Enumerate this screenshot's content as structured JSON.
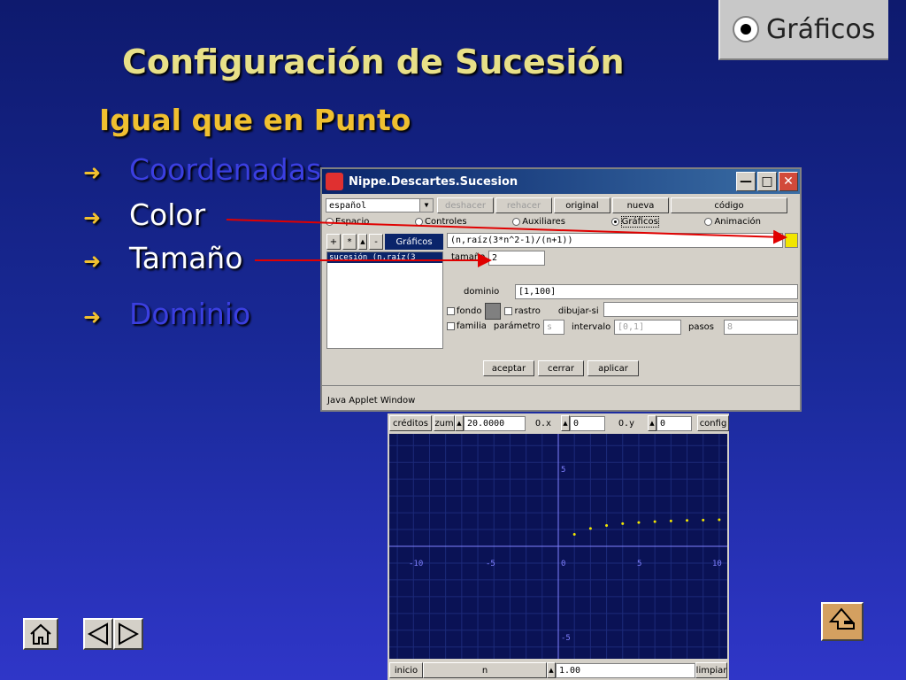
{
  "badge": {
    "label": "Gráficos"
  },
  "title": "Configuración de Sucesión",
  "subtitle": "Igual que en Punto",
  "bullets": {
    "b1": "Coordenadas",
    "b2": "Color",
    "b3": "Tamaño",
    "b4": "Dominio"
  },
  "applet": {
    "window_title": "Nippe.Descartes.Sucesion",
    "language": "español",
    "buttons": {
      "undo": "deshacer",
      "redo": "rehacer",
      "original": "original",
      "new": "nueva",
      "code": "código"
    },
    "tabs": {
      "t1": "Espacio",
      "t2": "Controles",
      "t3": "Auxiliares",
      "t4": "Gráficos",
      "t5": "Animación"
    },
    "list_buttons": {
      "add": "+",
      "star": "*",
      "minus": "-"
    },
    "list_header": "Gráficos",
    "list_item": "sucesión (n,raíz(3",
    "expression": "(n,raíz(3*n^2-1)/(n+1))",
    "color_swatch": "#f2e600",
    "size_label": "tamaño",
    "size_value": "2",
    "domain_label": "dominio",
    "domain_value": "[1,100]",
    "bg_label": "fondo",
    "trace_label": "rastro",
    "drawif_label": "dibujar-si",
    "family_label": "familia",
    "param_label": "parámetro",
    "param_value": "s",
    "interval_label": "intervalo",
    "interval_value": "[0,1]",
    "steps_label": "pasos",
    "steps_value": "8",
    "ok": "aceptar",
    "close": "cerrar",
    "apply": "aplicar",
    "status": "Java Applet Window"
  },
  "graph": {
    "credits": "créditos",
    "zoom_label": "zum",
    "zoom_value": "20.0000",
    "ox_label": "O.x",
    "ox_value": "0",
    "oy_label": "O.y",
    "oy_value": "0",
    "config": "config",
    "start": "inicio",
    "n_label": "n",
    "n_value": "1.00",
    "clear": "limpiar",
    "ticks": {
      "xm10": "-10",
      "xm5": "-5",
      "x0": "0",
      "x5": "5",
      "x10": "10",
      "y5": "5",
      "ym5": "-5"
    }
  },
  "chart_data": {
    "type": "scatter",
    "x": [
      1,
      2,
      3,
      4,
      5,
      6,
      7,
      8,
      9,
      10
    ],
    "y": [
      0.71,
      1.06,
      1.24,
      1.35,
      1.42,
      1.47,
      1.51,
      1.54,
      1.56,
      1.58
    ],
    "xlim": [
      -10.5,
      10.5
    ],
    "ylim": [
      -6.7,
      6.7
    ],
    "point_color": "#f2e600",
    "axis_color": "#8080ff",
    "grid": true
  }
}
